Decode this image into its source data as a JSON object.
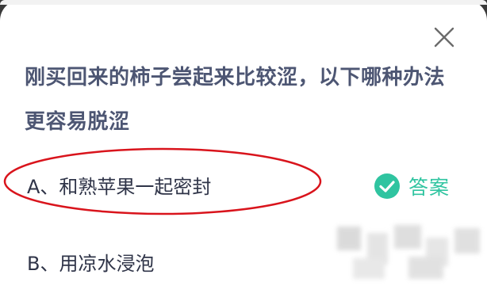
{
  "dialog": {
    "close_icon": "close-icon",
    "question": "刚买回来的柿子尝起来比较涩，以下哪种办法更容易脱涩",
    "options": [
      {
        "label": "A、和熟苹果一起密封"
      },
      {
        "label": "B、用凉水浸泡"
      }
    ],
    "answer_badge": {
      "icon": "check-circle-icon",
      "label": "答案",
      "color": "#2fc4a0"
    }
  }
}
